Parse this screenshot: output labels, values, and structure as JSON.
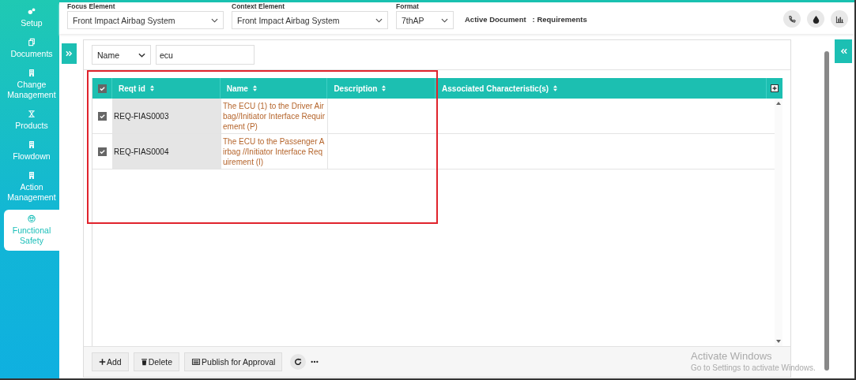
{
  "sidebar": {
    "items": [
      {
        "label": "Setup",
        "selected": false
      },
      {
        "label": "Documents",
        "selected": false
      },
      {
        "label": "Change Management",
        "selected": false
      },
      {
        "label": "Products",
        "selected": false
      },
      {
        "label": "Flowdown",
        "selected": false
      },
      {
        "label": "Action Management",
        "selected": false
      },
      {
        "label": "Functional Safety",
        "selected": true
      }
    ]
  },
  "toolbar": {
    "fields": [
      {
        "label": "Focus Element",
        "value": "Front Impact Airbag System"
      },
      {
        "label": "Context Element",
        "value": "Front Impact Airbag System"
      },
      {
        "label": "Format",
        "value": "7thAP"
      }
    ],
    "active_document": {
      "label": "Active Document",
      "value": ": Requirements"
    }
  },
  "filter": {
    "field": "Name",
    "query": "ecu"
  },
  "table": {
    "all_checked": true,
    "columns": [
      "Reqt id",
      "Name",
      "Description",
      "Associated Characteristic(s)"
    ],
    "rows": [
      {
        "checked": true,
        "reqt_id": "REQ-FIAS0003",
        "name": "The ECU (1) to the Driver Airbag//Initiator Interface Requirement (P)"
      },
      {
        "checked": true,
        "reqt_id": "REQ-FIAS0004",
        "name": "The ECU to the Passenger Airbag //Initiator Interface Requirement (I)"
      }
    ]
  },
  "footer": {
    "buttons": [
      "Add",
      "Delete",
      "Publish for Approval"
    ]
  },
  "watermark": {
    "title": "Activate Windows",
    "subtitle": "Go to Settings to activate Windows."
  }
}
